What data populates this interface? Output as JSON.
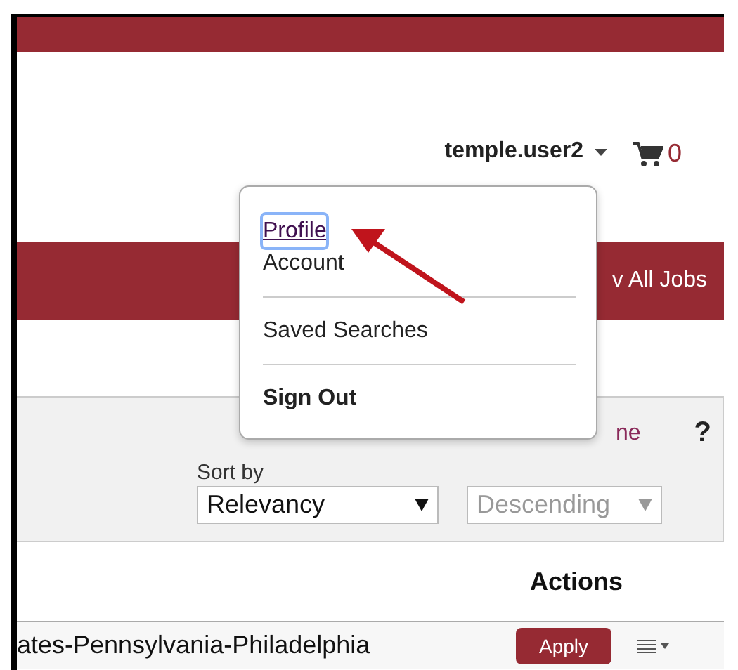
{
  "header": {
    "username": "temple.user2",
    "cart_count": "0"
  },
  "nav": {
    "link": "v All Jobs"
  },
  "user_menu": {
    "groups": [
      [
        {
          "label": "Profile",
          "focused": true,
          "bold": false
        },
        {
          "label": "Account",
          "focused": false,
          "bold": false
        }
      ],
      [
        {
          "label": "Saved Searches",
          "focused": false,
          "bold": false
        }
      ],
      [
        {
          "label": "Sign Out",
          "focused": false,
          "bold": true
        }
      ]
    ]
  },
  "search_panel": {
    "link": "ne",
    "help": "?",
    "sort_label": "Sort by",
    "sort": {
      "value": "Relevancy",
      "disabled": false
    },
    "order": {
      "value": "Descending",
      "disabled": true
    }
  },
  "table": {
    "columns": [
      "Actions"
    ],
    "rows": [
      {
        "location": "ates-Pennsylvania-Philadelphia",
        "button": "Apply"
      }
    ]
  }
}
